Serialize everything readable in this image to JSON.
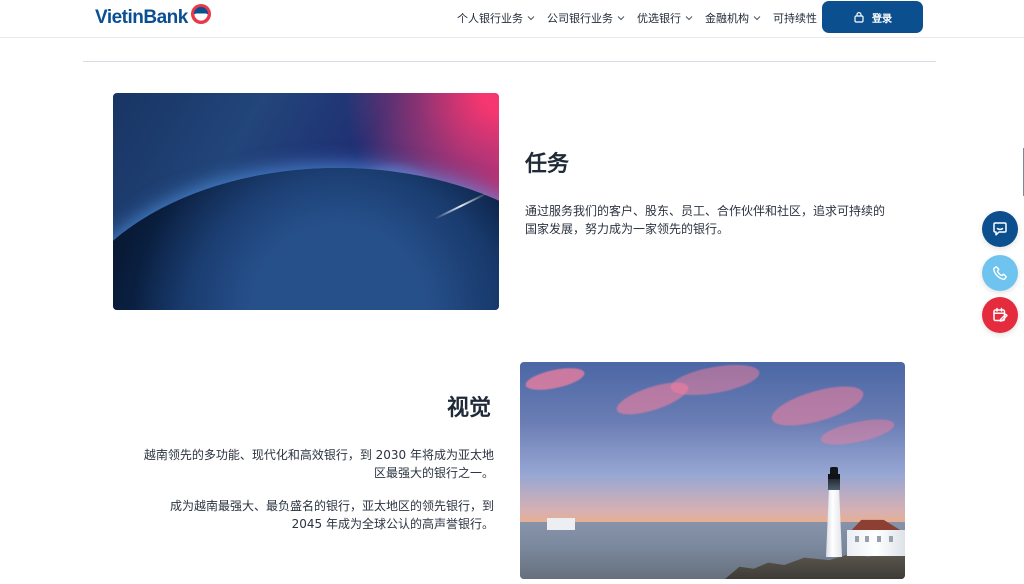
{
  "header": {
    "brand": "VietinBank",
    "nav": [
      {
        "label": "个人银行业务",
        "has_chevron": true
      },
      {
        "label": "公司银行业务",
        "has_chevron": true
      },
      {
        "label": "优选银行",
        "has_chevron": true
      },
      {
        "label": "金融机构",
        "has_chevron": true
      },
      {
        "label": "可持续性",
        "has_chevron": false
      }
    ],
    "login_label": "登录"
  },
  "mission": {
    "title": "任务",
    "text": "通过服务我们的客户、股东、员工、合作伙伴和社区，追求可持续的国家发展，努力成为一家领先的银行。"
  },
  "vision": {
    "title": "视觉",
    "text_1": "越南领先的多功能、现代化和高效银行，到 2030 年将成为亚太地区最强大的银行之一。",
    "text_2": "成为越南最强大、最负盛名的银行，亚太地区的领先银行，到 2045 年成为全球公认的高声誉银行。"
  },
  "floating_actions": [
    {
      "icon": "chat-icon",
      "color": "#0b4f8e"
    },
    {
      "icon": "phone-icon",
      "color": "#6fc3ef"
    },
    {
      "icon": "calendar-edit-icon",
      "color": "#e52c3f"
    }
  ],
  "colors": {
    "primary": "#0b4f8e",
    "danger": "#e52c3f",
    "accent": "#6fc3ef",
    "text": "#1f2937"
  }
}
